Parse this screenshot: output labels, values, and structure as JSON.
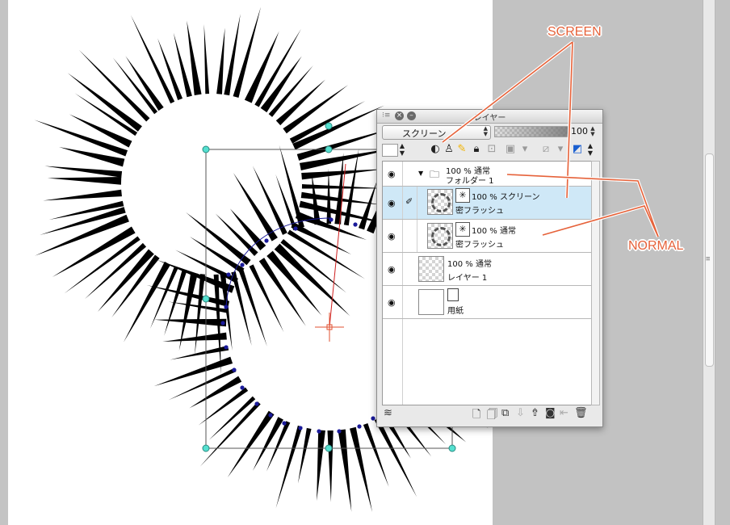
{
  "panel": {
    "title": "レイヤー",
    "blend_mode": "スクリーン",
    "opacity_value": "100",
    "opacity_level": 1.0
  },
  "layers": [
    {
      "line1": "100 % 通常",
      "line2": "フォルダー 1",
      "type": "folder",
      "selected": false
    },
    {
      "line1": "100 % スクリーン",
      "line2": "密フラッシュ",
      "type": "flash",
      "selected": true
    },
    {
      "line1": "100 % 通常",
      "line2": "密フラッシュ",
      "type": "flash",
      "selected": false
    },
    {
      "line1": "100 % 通常",
      "line2": "レイヤー 1",
      "type": "raster",
      "selected": false
    },
    {
      "line1": "",
      "line2": "用紙",
      "type": "paper",
      "selected": false
    }
  ],
  "annotations": {
    "screen": "SCREEN",
    "normal": "NORMAL"
  },
  "colors": {
    "annotation": "#e6623a",
    "selected_row": "#cfe8f7",
    "path": "#1a1a9a",
    "handle": "#55e0d0",
    "pivot": "#e05030"
  }
}
